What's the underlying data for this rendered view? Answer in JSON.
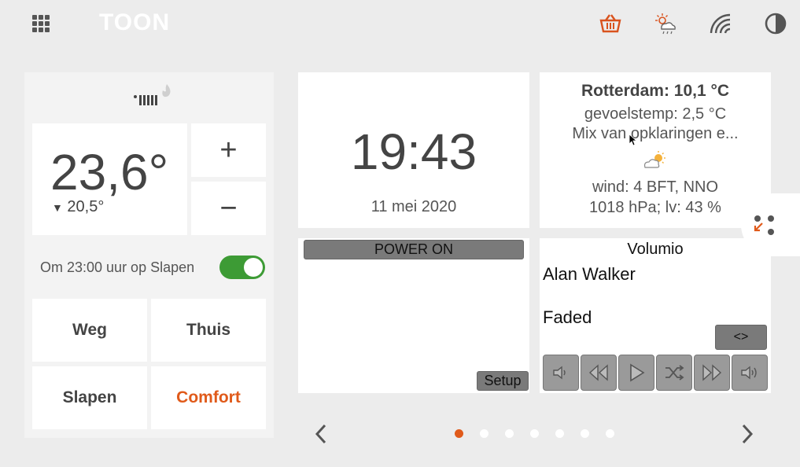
{
  "app": {
    "logo": "TOON"
  },
  "topbar": {
    "icons": [
      "apps-grid-icon",
      "basket-icon",
      "weather-icon",
      "wifi-icon",
      "contrast-icon"
    ]
  },
  "thermostat": {
    "current_temp": "23,6°",
    "setpoint_arrow": "▼",
    "setpoint": "20,5°",
    "plus_label": "+",
    "minus_label": "−",
    "schedule_text": "Om 23:00 uur op Slapen",
    "schedule_enabled": true,
    "presets": [
      "Weg",
      "Thuis",
      "Slapen",
      "Comfort"
    ],
    "active_preset": "Comfort",
    "colors": {
      "accent": "#e05a1a",
      "toggle_on": "#3d9b35"
    }
  },
  "clock": {
    "time": "19:43",
    "date": "11 mei 2020"
  },
  "weather": {
    "title": "Rotterdam: 10,1 °C",
    "feels_like": "gevoelstemp: 2,5 °C",
    "description": "Mix van opklaringen e...",
    "icon": "partly-cloudy-icon",
    "wind": "wind: 4 BFT, NNO",
    "pressure": "1018 hPa; lv: 43 %"
  },
  "power_tile": {
    "power_label": "POWER ON",
    "setup_label": "Setup"
  },
  "volumio": {
    "title": "Volumio",
    "artist": "Alan Walker",
    "track": "Faded",
    "toggle_label": "<>",
    "controls": [
      "volume-down-icon",
      "previous-icon",
      "play-icon",
      "shuffle-icon",
      "next-icon",
      "volume-up-icon"
    ]
  },
  "pager": {
    "dots": 7,
    "active_index": 0
  }
}
